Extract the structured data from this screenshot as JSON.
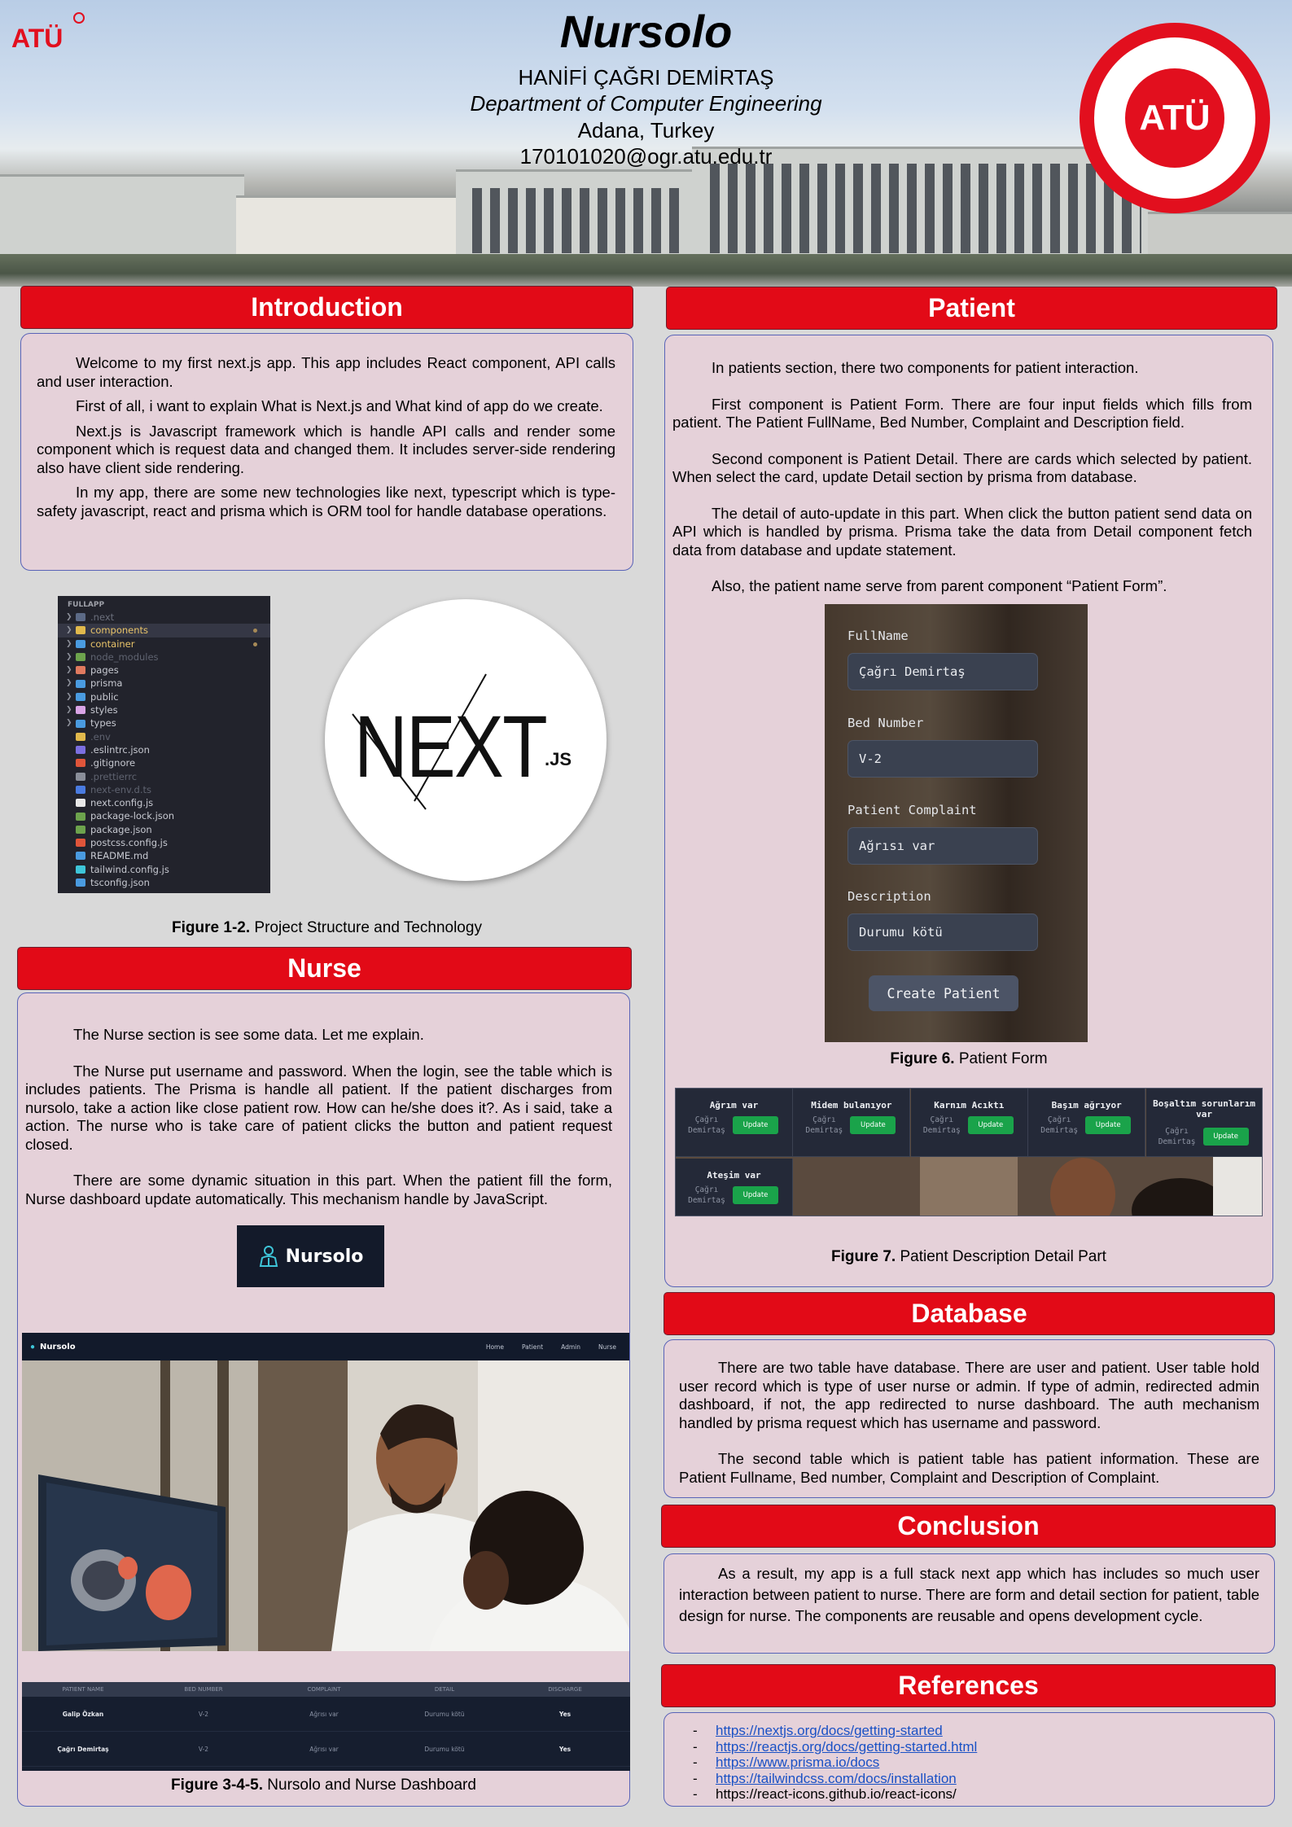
{
  "header": {
    "title": "Nursolo",
    "author": "HANİFİ ÇAĞRI DEMİRTAŞ",
    "department": "Department of Computer Engineering",
    "location": "Adana, Turkey",
    "email": "170101020@ogr.atu.edu.tr",
    "logo_text": "ATÜ"
  },
  "introduction": {
    "heading": "Introduction",
    "paragraphs": [
      "Welcome to my first next.js app. This app includes React component, API calls and user interaction.",
      "First of all, i want to explain What is Next.js and What kind of app do we create.",
      "Next.js is Javascript framework which is handle API calls and render some component which is request data and changed them. It includes server-side rendering also have client side rendering.",
      "In my app, there are some new technologies like next, typescript which is type-safety javascript, react and prisma which is ORM tool for handle database operations."
    ]
  },
  "file_tree": {
    "root": "FULLAPP",
    "items": [
      {
        "name": ".next",
        "color": "#6b6f7c",
        "icon": "#5c6a86",
        "arrow": true
      },
      {
        "name": "components",
        "color": "#e9c46a",
        "icon": "#e1b94c",
        "arrow": true,
        "selected": true,
        "dot": true
      },
      {
        "name": "container",
        "color": "#e9c46a",
        "icon": "#4a9be0",
        "arrow": true,
        "dot": true
      },
      {
        "name": "node_modules",
        "color": "#5f6370",
        "icon": "#6da34d",
        "arrow": true
      },
      {
        "name": "pages",
        "color": "#c7c9d1",
        "icon": "#e07a5f",
        "arrow": true
      },
      {
        "name": "prisma",
        "color": "#c7c9d1",
        "icon": "#4a9be0",
        "arrow": true
      },
      {
        "name": "public",
        "color": "#c7c9d1",
        "icon": "#4a9be0",
        "arrow": true
      },
      {
        "name": "styles",
        "color": "#c7c9d1",
        "icon": "#d9a4e6",
        "arrow": true
      },
      {
        "name": "types",
        "color": "#c7c9d1",
        "icon": "#4a9be0",
        "arrow": true
      },
      {
        "name": ".env",
        "color": "#5f6370",
        "icon": "#e1b94c",
        "arrow": false
      },
      {
        "name": ".eslintrc.json",
        "color": "#c7c9d1",
        "icon": "#7c6fe0",
        "arrow": false
      },
      {
        "name": ".gitignore",
        "color": "#c7c9d1",
        "icon": "#e0553a",
        "arrow": false
      },
      {
        "name": ".prettierrc",
        "color": "#5f6370",
        "icon": "#8a8e99",
        "arrow": false
      },
      {
        "name": "next-env.d.ts",
        "color": "#5f6370",
        "icon": "#4a7be0",
        "arrow": false
      },
      {
        "name": "next.config.js",
        "color": "#c7c9d1",
        "icon": "#e8e8e8",
        "arrow": false
      },
      {
        "name": "package-lock.json",
        "color": "#c7c9d1",
        "icon": "#6da34d",
        "arrow": false
      },
      {
        "name": "package.json",
        "color": "#c7c9d1",
        "icon": "#6da34d",
        "arrow": false
      },
      {
        "name": "postcss.config.js",
        "color": "#c7c9d1",
        "icon": "#e0553a",
        "arrow": false
      },
      {
        "name": "README.md",
        "color": "#c7c9d1",
        "icon": "#4a9be0",
        "arrow": false
      },
      {
        "name": "tailwind.config.js",
        "color": "#c7c9d1",
        "icon": "#3ec5d8",
        "arrow": false
      },
      {
        "name": "tsconfig.json",
        "color": "#c7c9d1",
        "icon": "#4a9be0",
        "arrow": false
      }
    ]
  },
  "next_logo": {
    "text": "NEXT",
    "suffix": ".JS"
  },
  "figure_1_2": {
    "label": "Figure 1-2.",
    "text": " Project Structure and Technology"
  },
  "nurse": {
    "heading": "Nurse",
    "paragraphs": [
      "The Nurse section is see some data. Let me explain.",
      "The Nurse put username and password. When the login, see the table which is includes patients. The Prisma is handle all patient. If the patient discharges from nursolo, take a action like close patient row. How can he/she does it?. As i said, take a action. The nurse who is take care of patient clicks the button and patient request closed.",
      "There are some dynamic situation in this part. When the patient fill the form, Nurse dashboard update automatically. This mechanism handle by JavaScript."
    ],
    "logo_text": "Nursolo"
  },
  "dashboard": {
    "brand": "Nursolo",
    "nav": [
      "Home",
      "Patient",
      "Admin",
      "Nurse"
    ]
  },
  "nurse_table": {
    "headers": [
      "PATIENT NAME",
      "BED NUMBER",
      "COMPLAINT",
      "DETAIL",
      "DISCHARGE"
    ],
    "rows": [
      [
        "Galip Özkan",
        "V-2",
        "Ağrısı var",
        "Durumu kötü",
        "Yes"
      ],
      [
        "Çağrı Demirtaş",
        "V-2",
        "Ağrısı var",
        "Durumu kötü",
        "Yes"
      ]
    ]
  },
  "figure_3_4_5": {
    "label": "Figure 3-4-5.",
    "text": " Nursolo and Nurse Dashboard"
  },
  "patient": {
    "heading": "Patient",
    "paragraphs": [
      "In patients section, there two components for patient interaction.",
      "First component is Patient Form. There are four input fields which fills from patient. The Patient FullName, Bed Number, Complaint and Description field.",
      "Second component is Patient Detail. There are cards which selected by patient. When select the card, update Detail section by prisma from database.",
      "The detail of auto-update in this part. When click the button patient send data on API which is handled by prisma. Prisma take the data from Detail component fetch data from database and update statement.",
      "Also, the patient name serve from parent component “Patient Form”."
    ]
  },
  "patient_form": {
    "fields": [
      {
        "label": "FullName",
        "value": "Çağrı Demirtaş"
      },
      {
        "label": "Bed Number",
        "value": "V-2"
      },
      {
        "label": "Patient Complaint",
        "value": "Ağrısı var"
      },
      {
        "label": "Description",
        "value": "Durumu kötü"
      }
    ],
    "button": "Create Patient"
  },
  "figure_6": {
    "label": "Figure 6.",
    "text": " Patient Form"
  },
  "patient_cards": [
    {
      "title": "Ağrım var",
      "name": "Çağrı Demirtaş",
      "button": "Update"
    },
    {
      "title": "Midem bulanıyor",
      "name": "Çağrı Demirtaş",
      "button": "Update"
    },
    {
      "title": "Karnım Acıktı",
      "name": "Çağrı Demirtaş",
      "button": "Update"
    },
    {
      "title": "Başım ağrıyor",
      "name": "Çağrı Demirtaş",
      "button": "Update"
    },
    {
      "title": "Boşaltım sorunlarım var",
      "name": "Çağrı Demirtaş",
      "button": "Update"
    },
    {
      "title": "Ateşim var",
      "name": "Çağrı Demirtaş",
      "button": "Update"
    }
  ],
  "figure_7": {
    "label": "Figure 7.",
    "text": " Patient Description Detail Part"
  },
  "database": {
    "heading": "Database",
    "paragraphs": [
      "There are two table have database. There are user and patient. User table hold user record which is type of user nurse or admin. If type of admin, redirected admin dashboard, if not, the app redirected to nurse dashboard. The auth mechanism handled by prisma request which has username and password.",
      "The second table which is patient table has patient information. These are Patient Fullname, Bed number, Complaint and Description of Complaint."
    ]
  },
  "conclusion": {
    "heading": "Conclusion",
    "paragraphs": [
      "As a result, my app is a full stack next app which has includes so much user interaction between patient to nurse. There are form and detail section for patient, table design for nurse. The components are reusable and opens development cycle."
    ]
  },
  "references": {
    "heading": "References",
    "items": [
      {
        "text": "https://nextjs.org/docs/getting-started",
        "link": true
      },
      {
        "text": "https://reactjs.org/docs/getting-started.html",
        "link": true
      },
      {
        "text": "https://www.prisma.io/docs",
        "link": true
      },
      {
        "text": "https://tailwindcss.com/docs/installation",
        "link": true
      },
      {
        "text": "https://react-icons.github.io/react-icons/",
        "link": false
      }
    ]
  },
  "colors": {
    "accent": "#e20a17",
    "panel": "#e5d1d9",
    "panel_border": "#5963b7",
    "page": "#d9d9d9"
  }
}
